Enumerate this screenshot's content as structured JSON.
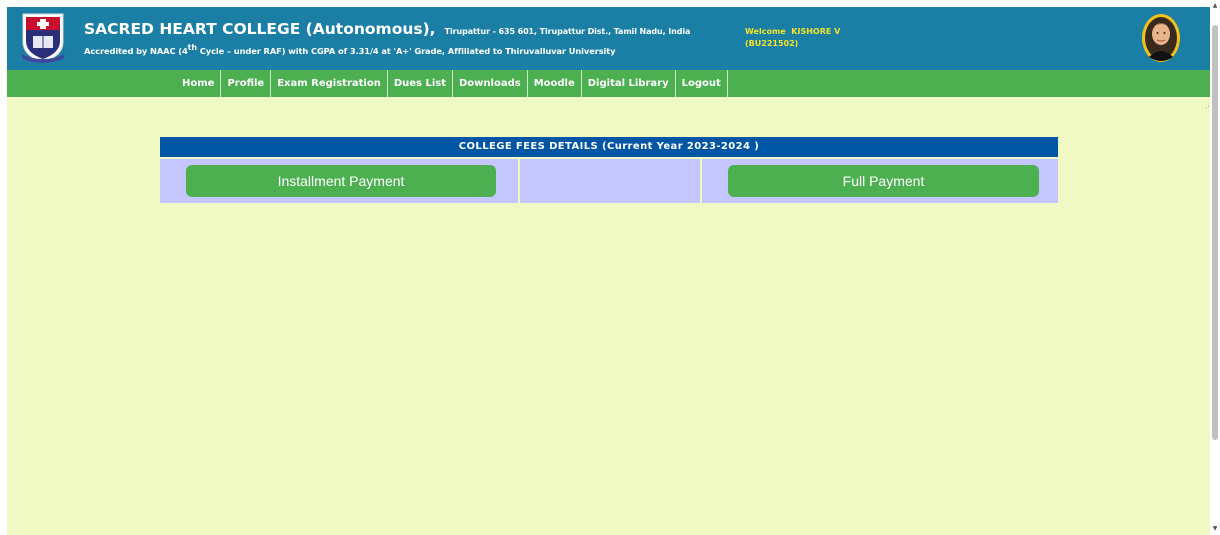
{
  "header": {
    "college_name": "SACRED HEART COLLEGE (Autonomous),",
    "address": "Tirupattur - 635 601, Tirupattur Dist., Tamil Nadu, India",
    "accreditation_prefix": "Accredited by NAAC (4",
    "accreditation_sup": "th",
    "accreditation_suffix": " Cycle – under RAF) with CGPA of 3.31/4 at 'A+' Grade, Affiliated to Thiruvalluvar University",
    "welcome_text": "Welcome  KISHORE V",
    "user_id": "(BU221502)",
    "logo_icon": "college-crest-icon",
    "avatar_icon": "profile-portrait-icon"
  },
  "nav": {
    "items": [
      {
        "label": "Home"
      },
      {
        "label": "Profile"
      },
      {
        "label": "Exam Registration"
      },
      {
        "label": "Dues List"
      },
      {
        "label": "Downloads"
      },
      {
        "label": "Moodle"
      },
      {
        "label": "Digital Library"
      },
      {
        "label": "Logout"
      }
    ]
  },
  "fees": {
    "heading": "COLLEGE FEES DETAILS (Current Year 2023-2024 )",
    "installment_label": "Installment Payment",
    "full_label": "Full Payment"
  },
  "colors": {
    "header_bg": "#1b7fa5",
    "nav_bg": "#4caf50",
    "page_bg": "#f0f8c4",
    "heading_bg": "#0055a5",
    "cell_bg": "#c5c5ff",
    "button_bg": "#4caf50",
    "welcome_text": "#f5e32a"
  }
}
